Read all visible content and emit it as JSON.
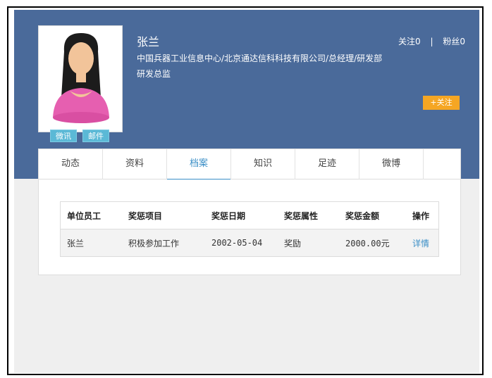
{
  "profile": {
    "name": "张兰",
    "org_line1": "中国兵器工业信息中心/北京通达信科科技有限公司/总经理/研发部",
    "org_line2": "研发总监",
    "wechat_label": "微讯",
    "mail_label": "邮件",
    "follow_label": "关注0",
    "fans_label": "粉丝0",
    "separator": "|",
    "follow_button": "+关注"
  },
  "tabs": [
    {
      "label": "动态"
    },
    {
      "label": "资料"
    },
    {
      "label": "档案"
    },
    {
      "label": "知识"
    },
    {
      "label": "足迹"
    },
    {
      "label": "微博"
    }
  ],
  "active_tab": "档案",
  "table": {
    "columns": [
      "单位员工",
      "奖惩项目",
      "奖惩日期",
      "奖惩属性",
      "奖惩金额",
      "操作"
    ],
    "rows": [
      [
        "张兰",
        "积极参加工作",
        "2002-05-04",
        "奖励",
        "2000.00元",
        "详情"
      ]
    ]
  },
  "colors": {
    "header_bg": "#4a6a9a",
    "accent": "#3a8ec6",
    "follow_button": "#f5a623",
    "tag_bg": "#5bb9d6"
  }
}
